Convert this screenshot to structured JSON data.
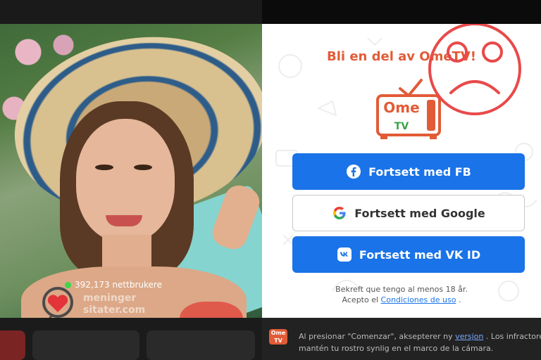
{
  "video": {
    "online_count": "392,173 nettbrukere",
    "watermark_line1": "meninger",
    "watermark_line2": "sitater.com"
  },
  "login": {
    "title": "Bli en del av OmeTV!",
    "logo_line1": "Ome",
    "logo_line2": "TV",
    "buttons": [
      {
        "label": "Fortsett med  FB",
        "icon": "facebook-icon"
      },
      {
        "label": "Fortsett med  Google",
        "icon": "google-icon"
      },
      {
        "label": "Fortsett med  VK ID",
        "icon": "vk-icon"
      }
    ],
    "confirm_line1": "Bekreft que tengo al menos 18 år.",
    "confirm_prefix": "Acepto el ",
    "confirm_link": "Condiciones de uso",
    "confirm_suffix": " ."
  },
  "notice": {
    "logo_text": "Ome TV",
    "line1_prefix": "Al presionar \"Comenzar\", aksepterer ny ",
    "line1_link": "versjon",
    "line1_suffix": " . Los infractores de las",
    "line2": "mantén tu rostro synlig en el marco de la cámara."
  },
  "colors": {
    "accent_orange": "#e25b37",
    "button_blue": "#1a73e8",
    "online_green": "#39d84a",
    "sad_face_red": "#e84a4a"
  }
}
